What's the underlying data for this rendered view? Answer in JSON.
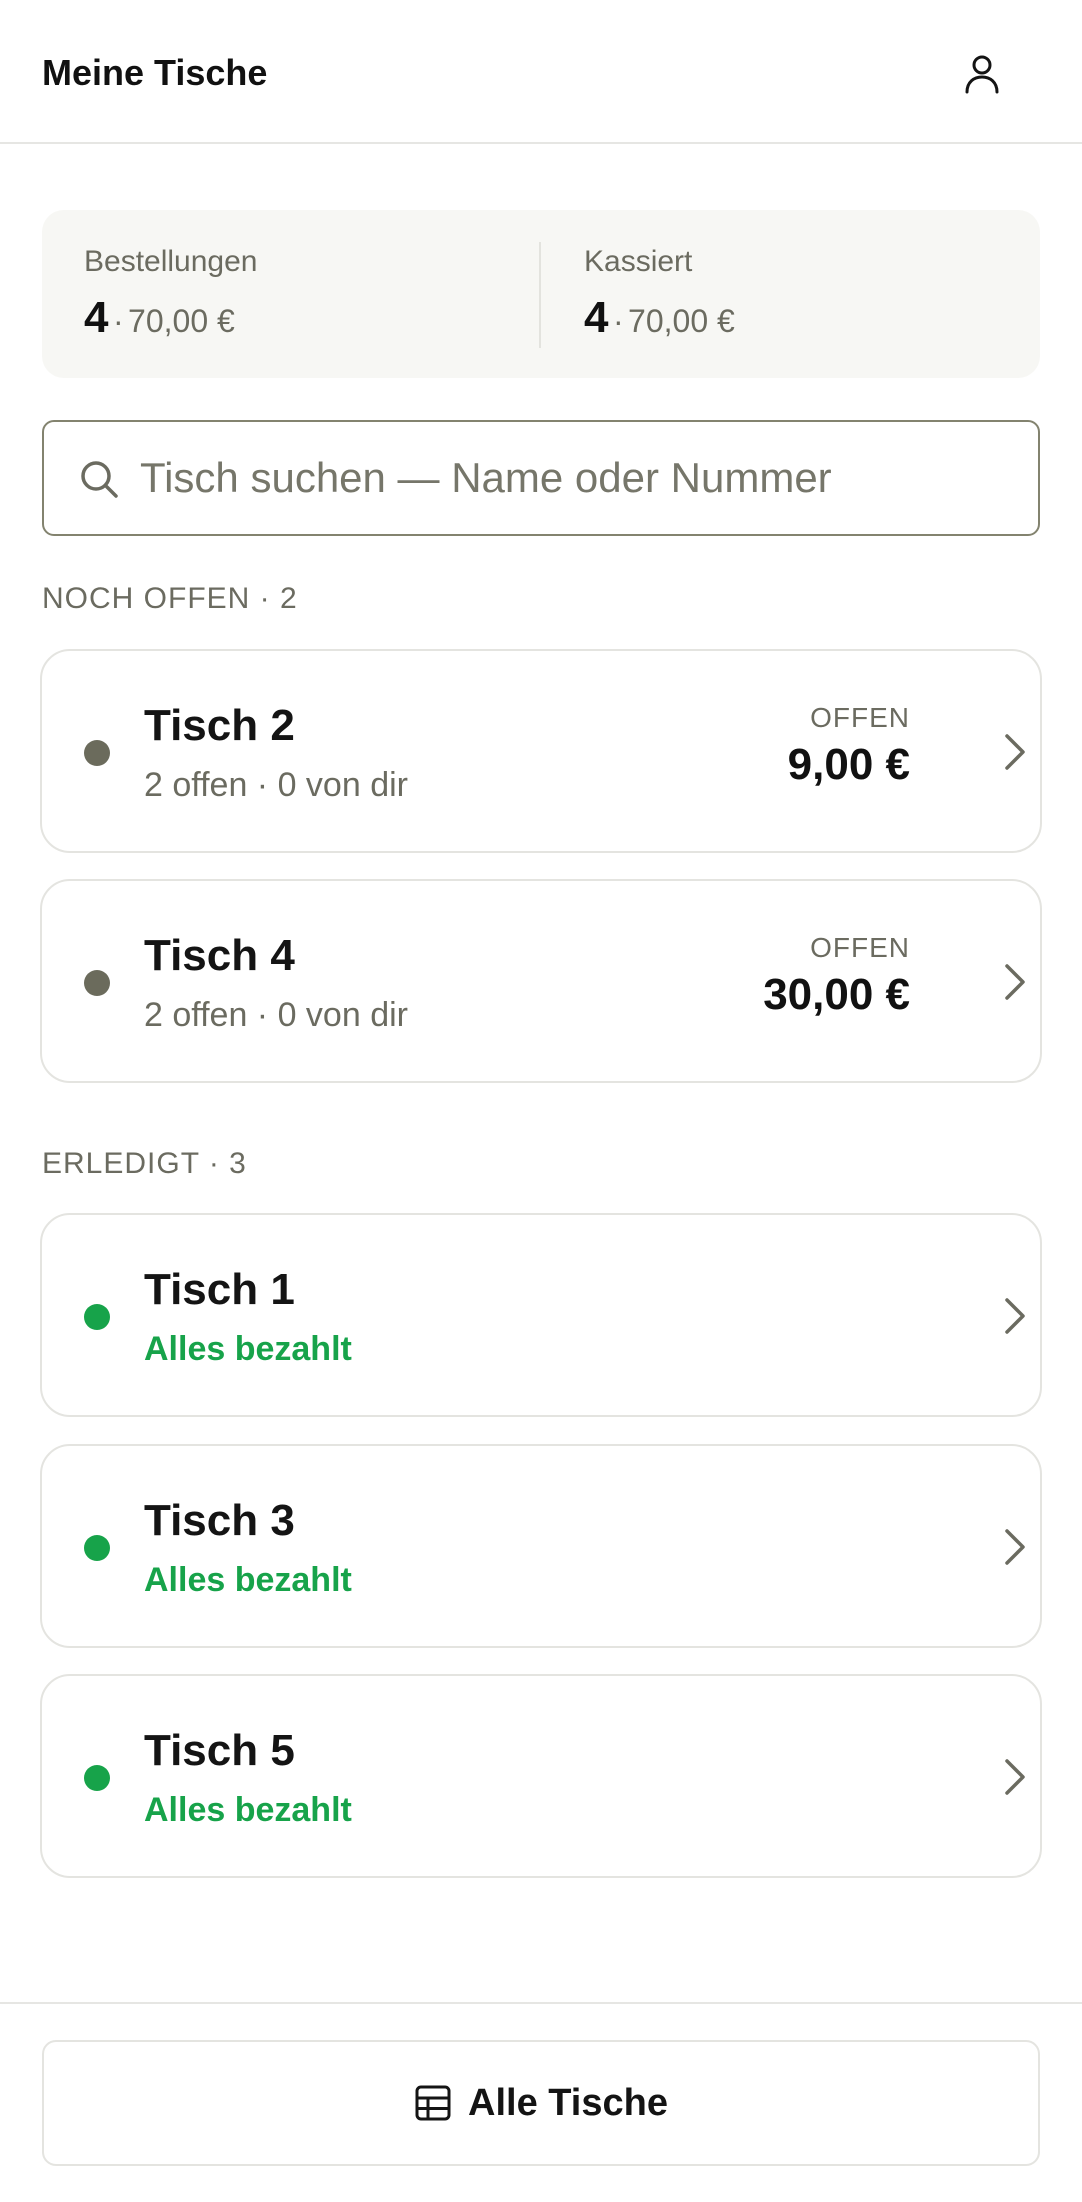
{
  "header": {
    "title": "Meine Tische",
    "user_icon": "user-icon"
  },
  "summary": {
    "orders": {
      "label": "Bestellungen",
      "count": "4",
      "separator": "·",
      "amount": "70,00 €"
    },
    "collected": {
      "label": "Kassiert",
      "count": "4",
      "separator": "·",
      "amount": "70,00 €"
    }
  },
  "search": {
    "placeholder": "Tisch suchen — Name oder Nummer",
    "value": "",
    "icon": "search-icon"
  },
  "sections": {
    "open": {
      "header": "NOCH OFFEN · 2",
      "items": [
        {
          "title": "Tisch 2",
          "subtitle": "2 offen · 0 von dir",
          "status": "OFFEN",
          "amount": "9,00 €"
        },
        {
          "title": "Tisch 4",
          "subtitle": "2 offen · 0 von dir",
          "status": "OFFEN",
          "amount": "30,00 €"
        }
      ]
    },
    "done": {
      "header": "ERLEDIGT · 3",
      "items": [
        {
          "title": "Tisch 1",
          "subtitle": "Alles bezahlt"
        },
        {
          "title": "Tisch 3",
          "subtitle": "Alles bezahlt"
        },
        {
          "title": "Tisch 5",
          "subtitle": "Alles bezahlt"
        }
      ]
    }
  },
  "footer": {
    "all_tables_label": "Alle Tische",
    "icon": "table-grid-icon"
  },
  "colors": {
    "open_dot": "#6b6b5c",
    "done": "#17a34a",
    "muted_text": "#6b6b60",
    "summary_bg": "#f7f7f4"
  }
}
